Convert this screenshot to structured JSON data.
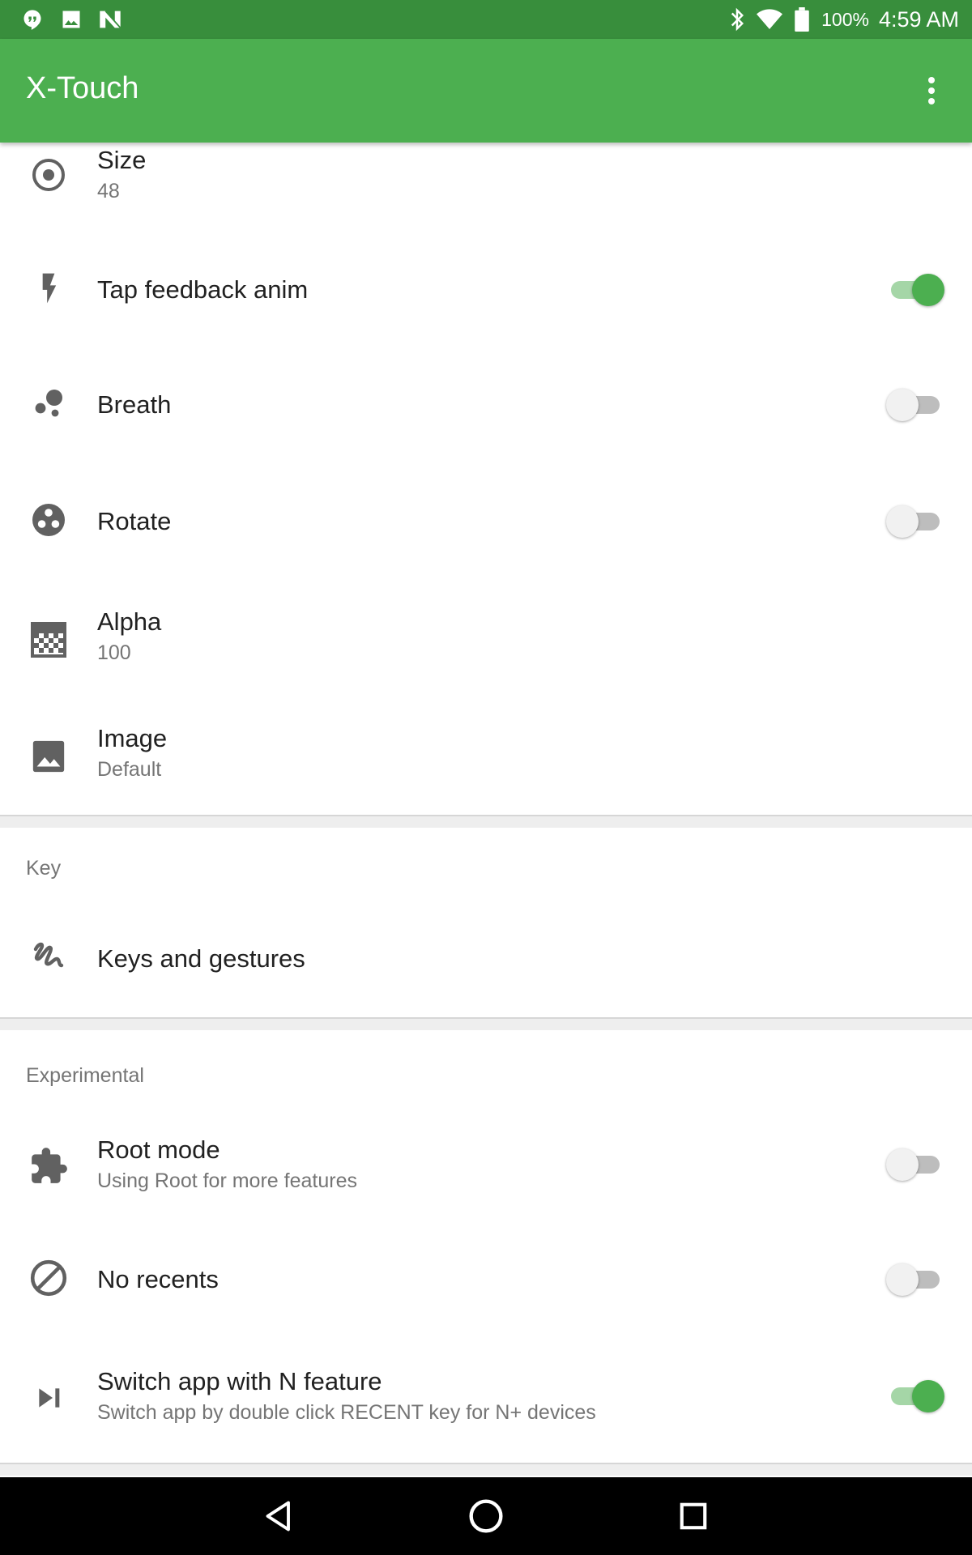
{
  "status_bar": {
    "left_icons": [
      "hangouts-icon",
      "image-notification-icon",
      "n-notification-icon"
    ],
    "battery": "100%",
    "time": "4:59 AM"
  },
  "app_bar": {
    "title": "X-Touch"
  },
  "prefs": {
    "size": {
      "title": "Size",
      "summary": "48",
      "icon": "radio-target-icon"
    },
    "tap_feedback": {
      "title": "Tap feedback anim",
      "icon": "flash-icon",
      "enabled": true
    },
    "breath": {
      "title": "Breath",
      "icon": "bubbles-icon",
      "enabled": false
    },
    "rotate": {
      "title": "Rotate",
      "icon": "rotate-circle-icon",
      "enabled": false
    },
    "alpha": {
      "title": "Alpha",
      "summary": "100",
      "icon": "transparency-icon"
    },
    "image": {
      "title": "Image",
      "summary": "Default",
      "icon": "image-icon"
    }
  },
  "key_section": {
    "header": "Key",
    "keys_gestures": {
      "title": "Keys and gestures",
      "icon": "gesture-icon"
    }
  },
  "experimental_section": {
    "header": "Experimental",
    "root_mode": {
      "title": "Root mode",
      "summary": "Using Root for more features",
      "icon": "puzzle-icon",
      "enabled": false
    },
    "no_recents": {
      "title": "No recents",
      "icon": "block-icon",
      "enabled": false
    },
    "switch_app": {
      "title": "Switch app with N feature",
      "summary": "Switch app by double click RECENT key for N+ devices",
      "icon": "skip-next-icon",
      "enabled": true
    }
  },
  "colors": {
    "status_bar": "#388e3c",
    "app_bar": "#4caf50",
    "switch_on": "#4caf50",
    "switch_off": "#bdbdbd"
  }
}
